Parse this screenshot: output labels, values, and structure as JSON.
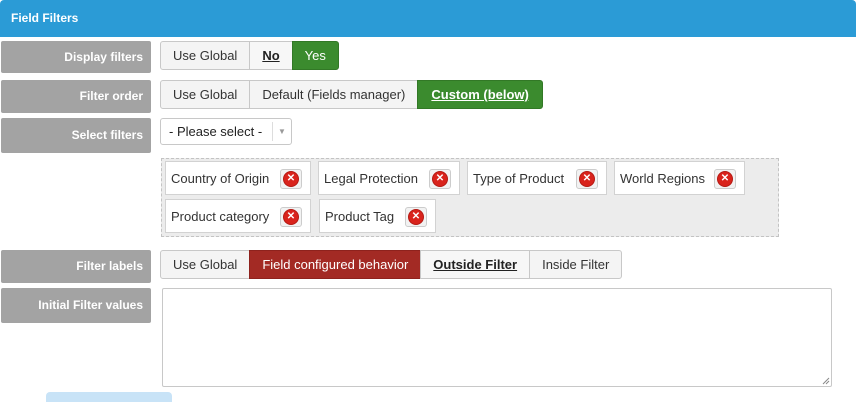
{
  "header": {
    "title": "Field Filters"
  },
  "rows": {
    "display_filters": {
      "label": "Display filters",
      "options": [
        "Use Global",
        "No",
        "Yes"
      ]
    },
    "filter_order": {
      "label": "Filter order",
      "options": [
        "Use Global",
        "Default (Fields manager)",
        "Custom (below)"
      ]
    },
    "select_filters": {
      "label": "Select filters",
      "select_value": "- Please select -",
      "chips": [
        "Country of Origin",
        "Legal Protection",
        "Type of Product",
        "World Regions",
        "Product category",
        "Product Tag"
      ]
    },
    "filter_labels": {
      "label": "Filter labels",
      "options": [
        "Use Global",
        "Field configured behavior",
        "Outside Filter",
        "Inside Filter"
      ]
    },
    "initial_values": {
      "label": "Initial Filter values",
      "value": ""
    }
  },
  "colors": {
    "header_bg": "#2b9bd6",
    "label_bg": "#a3a3a3",
    "active_green": "#3b8b2e",
    "active_red": "#a32a24",
    "remove_icon": "#d9231c"
  },
  "icons": {
    "remove": "remove-circle-icon",
    "dropdown": "caret-down-icon"
  }
}
